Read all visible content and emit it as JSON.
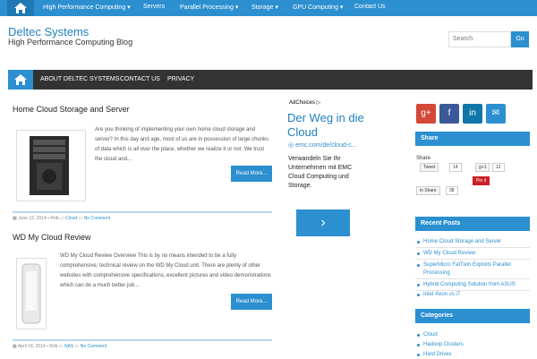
{
  "topnav": {
    "items": [
      "High Performance Computing ▾",
      "Servers",
      "Parallel Processing ▾",
      "Storage ▾",
      "GPU Computing ▾",
      "Contact Us"
    ]
  },
  "site": {
    "title": "Deltec Systems",
    "tagline": "High Performance Computing Blog"
  },
  "search": {
    "placeholder": "Search",
    "button": "Go"
  },
  "mainnav": {
    "items": [
      "ABOUT DELTEC SYSTEMS",
      "CONTACT US",
      "PRIVACY"
    ]
  },
  "posts": [
    {
      "title": "Home Cloud Storage and Server",
      "excerpt": "Are you thinking of implementing your own home cloud storage and server? In this day and age, most of us are in possession of large chunks of data which is all over the place, whether we realize it or not. We trust the cloud and...",
      "more": "Read More...",
      "date": "June 12, 2014",
      "author": "Rob",
      "category": "Cloud",
      "comments": "No Comment"
    },
    {
      "title": "WD My Cloud Review",
      "excerpt": "WD My Cloud Review Overview This is by no means intended to be a fully comprehensive, technical review on the WD My Cloud unit. There are plenty of other websites with comprehensive specifications, excellent pictures and video demonstrations which can do a much better job...",
      "more": "Read More...",
      "date": "April 18, 2014",
      "author": "Rob",
      "category": "NAS",
      "comments": "No Comment"
    }
  ],
  "ad": {
    "label": "AdChoices ▷",
    "headline": "Der Weg in die Cloud",
    "url": "emc.com/de/cloud-c...",
    "body": "Verwandeln Sie Ihr Unternehmen mit EMC Cloud Computing und Storage.",
    "button": "›"
  },
  "social": [
    "g+",
    "f",
    "in",
    "✉"
  ],
  "share": {
    "heading": "Share",
    "label": "Share",
    "tweet": "Tweet",
    "tweet_count": "14",
    "gplus": "g+1",
    "gplus_count": "12",
    "pin": "Pin it",
    "linkedin": "in Share",
    "linkedin_count": "38"
  },
  "recent": {
    "heading": "Recent Posts",
    "items": [
      "Home Cloud Storage and Server",
      "WD My Cloud Review",
      "SuperMicro FatTwin Exploits Parallel Processing",
      "Hybrid Computing Solution from ASUS",
      "Intel Xeon vs i7"
    ]
  },
  "categories": {
    "heading": "Categories",
    "items": [
      "Cloud",
      "Hadoop Clusters",
      "Hard Drives"
    ]
  },
  "colors": {
    "accent": "#2b8fd0",
    "nav_dark": "#333333"
  }
}
